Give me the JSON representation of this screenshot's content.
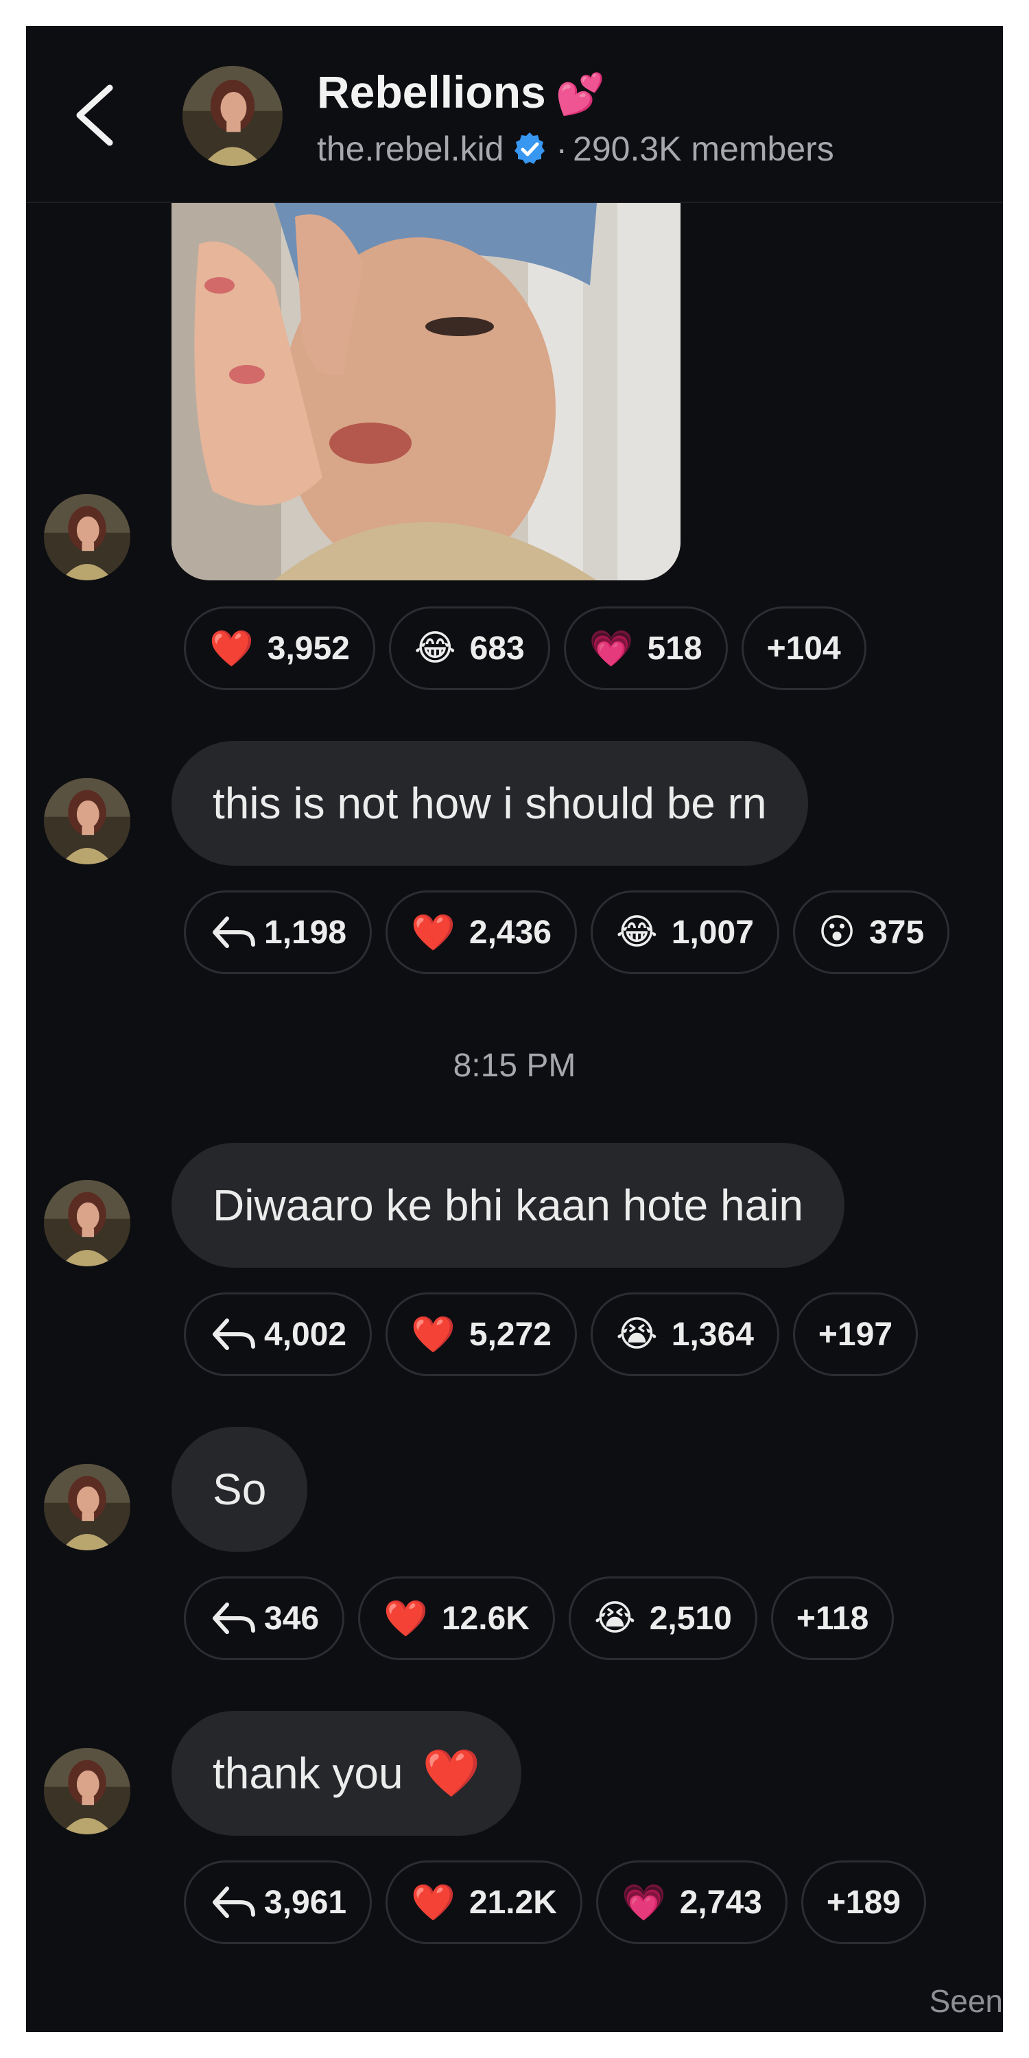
{
  "header": {
    "title": "Rebellions",
    "title_emoji": "💕",
    "handle": "the.rebel.kid",
    "separator": "·",
    "member_count": "290.3K members"
  },
  "messages": [
    {
      "type": "image",
      "reactions": [
        {
          "emoji": "❤️",
          "count": "3,952"
        },
        {
          "emoji": "😂",
          "count": "683"
        },
        {
          "emoji": "💗",
          "count": "518"
        },
        {
          "emoji": "",
          "count": "+104"
        }
      ]
    },
    {
      "type": "text",
      "text": "this is not how i should be rn",
      "replies": "1,198",
      "reactions": [
        {
          "emoji": "❤️",
          "count": "2,436"
        },
        {
          "emoji": "😂",
          "count": "1,007"
        },
        {
          "emoji": "😮",
          "count": "375"
        }
      ]
    },
    {
      "type": "text",
      "text": "Diwaaro ke bhi kaan hote hain",
      "replies": "4,002",
      "reactions": [
        {
          "emoji": "❤️",
          "count": "5,272"
        },
        {
          "emoji": "😭",
          "count": "1,364"
        },
        {
          "emoji": "",
          "count": "+197"
        }
      ]
    },
    {
      "type": "text",
      "text": "So",
      "replies": "346",
      "reactions": [
        {
          "emoji": "❤️",
          "count": "12.6K"
        },
        {
          "emoji": "😭",
          "count": "2,510"
        },
        {
          "emoji": "",
          "count": "+118"
        }
      ]
    },
    {
      "type": "text",
      "text": "thank you",
      "text_emoji": "❤️",
      "replies": "3,961",
      "reactions": [
        {
          "emoji": "❤️",
          "count": "21.2K"
        },
        {
          "emoji": "💗",
          "count": "2,743"
        },
        {
          "emoji": "",
          "count": "+189"
        }
      ]
    }
  ],
  "timestamp": "8:15 PM",
  "status": "Seen",
  "icons": {
    "back": "chevron-left-icon",
    "verified": "verified-badge-icon",
    "reply": "reply-arrow-icon"
  },
  "colors": {
    "background": "#0d0e12",
    "bubble": "#26272b",
    "verified": "#3897f0"
  }
}
